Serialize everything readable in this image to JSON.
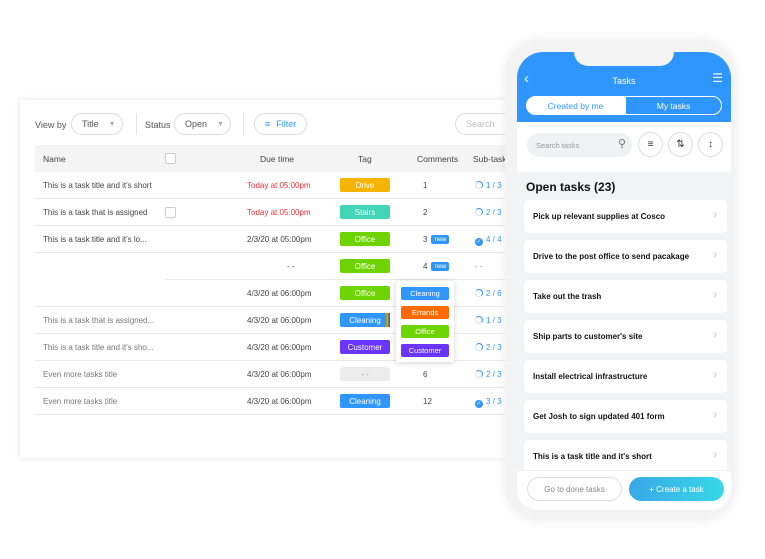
{
  "toolbar": {
    "view_by_label": "View by",
    "view_by_value": "Title",
    "status_label": "Status",
    "status_value": "Open",
    "filter_label": "Filter",
    "search_placeholder": "Search"
  },
  "columns": [
    "Name",
    "Due time",
    "Tag",
    "Comments",
    "Sub-tasks"
  ],
  "rows": [
    {
      "name": "This is a task title and it's short",
      "due": "Today at 05:00pm",
      "due_overdue": true,
      "tag": "Drive",
      "tag_color": "#f5b400",
      "comments": "1",
      "new": false,
      "subtasks": "1 / 3",
      "sub_done": false,
      "checkbox": false
    },
    {
      "name": "This is a task that is assigned",
      "due": "Today at 05:00pm",
      "due_overdue": true,
      "tag": "Stairs",
      "tag_color": "#3fd5b5",
      "comments": "2",
      "new": false,
      "subtasks": "2 / 3",
      "sub_done": false,
      "checkbox": true
    },
    {
      "name": "This is a task title and it's lo...",
      "due": "2/3/20 at 05:00pm",
      "tag": "Office",
      "tag_color": "#6ed400",
      "comments": "3",
      "new": true,
      "subtasks": "4 / 4",
      "sub_done": true
    },
    {
      "name": "",
      "due": "- -",
      "tag": "Office",
      "tag_color": "#6ed400",
      "comments": "4",
      "new": true,
      "subtasks": "- -",
      "indent": true
    },
    {
      "name": "",
      "due": "4/3/20 at 06:00pm",
      "tag": "Office",
      "tag_color": "#6ed400",
      "comments": "",
      "subtasks": "2 / 6",
      "sub_done": false
    },
    {
      "name": "This is a task that is assigned...",
      "due": "4/3/20 at 06:00pm",
      "tag": "Cleaning",
      "tag_color": "#2f96ff",
      "comments": "",
      "subtasks": "1 / 3",
      "sub_done": false
    },
    {
      "name": "This is a task title and it's sho...",
      "due": "4/3/20 at 06:00pm",
      "tag": "Customer",
      "tag_color": "#6a35ff",
      "comments": "",
      "subtasks": "2 / 3",
      "sub_done": false
    },
    {
      "name": "Even more tasks title",
      "due": "4/3/20 at 06:00pm",
      "tag": "- -",
      "tag_color": "#ececec",
      "comments": "6",
      "subtasks": "2 / 3",
      "sub_done": false
    },
    {
      "name": "Even more tasks title",
      "due": "4/3/20 at 06:00pm",
      "tag": "Cleaning",
      "tag_color": "#2f96ff",
      "comments": "12",
      "subtasks": "3 / 3",
      "sub_done": true
    }
  ],
  "new_badge": "new",
  "tag_dropdown": [
    {
      "label": "Cleaning",
      "color": "#2f96ff"
    },
    {
      "label": "Errands",
      "color": "#ff6a00"
    },
    {
      "label": "Office",
      "color": "#6ed400"
    },
    {
      "label": "Customer",
      "color": "#6a35ff"
    }
  ],
  "phone": {
    "title": "Tasks",
    "tabs": [
      "Created by me",
      "My tasks"
    ],
    "search_placeholder": "Search tasks",
    "section_title": "Open tasks (23)",
    "tasks": [
      "Pick up relevant supplies at Cosco",
      "Drive to the post office to send pacakage",
      "Take out the trash",
      "Ship parts to customer's site",
      "Install electrical infrastructure",
      "Get Josh to sign updated 401 form",
      "This is a task title and it's short"
    ],
    "done_button": "Go to done tasks",
    "create_button": "+ Create a task"
  },
  "colors": {
    "accent": "#2f96ff",
    "overdue": "#e8333a"
  }
}
